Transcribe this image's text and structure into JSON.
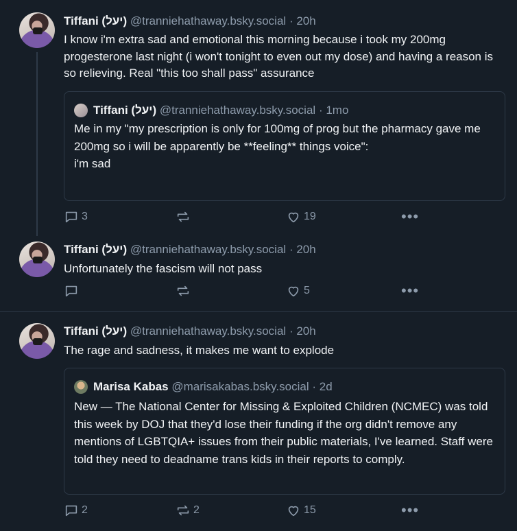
{
  "posts": [
    {
      "author": "Tiffani (יעל)",
      "handle": "@tranniehathaway.bsky.social",
      "sep": "·",
      "time": "20h",
      "text": "I know i'm extra sad and emotional this morning because i took my 200mg progesterone last night (i won't tonight to even out my dose) and having a reason is so relieving. Real \"this too shall pass\" assurance",
      "quote": {
        "author": "Tiffani (יעל)",
        "handle": "@tranniehathaway.bsky.social",
        "sep": "·",
        "time": "1mo",
        "text": "Me in my \"my prescription is only for 100mg of prog but the pharmacy gave me 200mg so i will be apparently be **feeling** things voice\":\ni'm sad"
      },
      "replies": "3",
      "reposts": "",
      "likes": "19"
    },
    {
      "author": "Tiffani (יעל)",
      "handle": "@tranniehathaway.bsky.social",
      "sep": "·",
      "time": "20h",
      "text": "Unfortunately the fascism will not pass",
      "replies": "",
      "reposts": "",
      "likes": "5"
    },
    {
      "author": "Tiffani (יעל)",
      "handle": "@tranniehathaway.bsky.social",
      "sep": "·",
      "time": "20h",
      "text": "The rage and sadness, it makes me want to explode",
      "quote": {
        "author": "Marisa Kabas",
        "handle": "@marisakabas.bsky.social",
        "sep": "·",
        "time": "2d",
        "text": "New — The National Center for Missing & Exploited Children (NCMEC) was told this week by DOJ that they'd lose their funding if the org didn't remove any mentions of LGBTQIA+ issues from their public materials, I've learned. Staff were told they need to deadname trans kids in their reports to comply."
      },
      "replies": "2",
      "reposts": "2",
      "likes": "15"
    }
  ],
  "icons": {
    "reply": "reply-icon",
    "repost": "repost-icon",
    "like": "heart-icon",
    "more": "more-icon"
  },
  "colors": {
    "background": "#161e27",
    "text": "#f1f3f5",
    "muted": "#8d9bab",
    "border": "#2e3a48"
  }
}
